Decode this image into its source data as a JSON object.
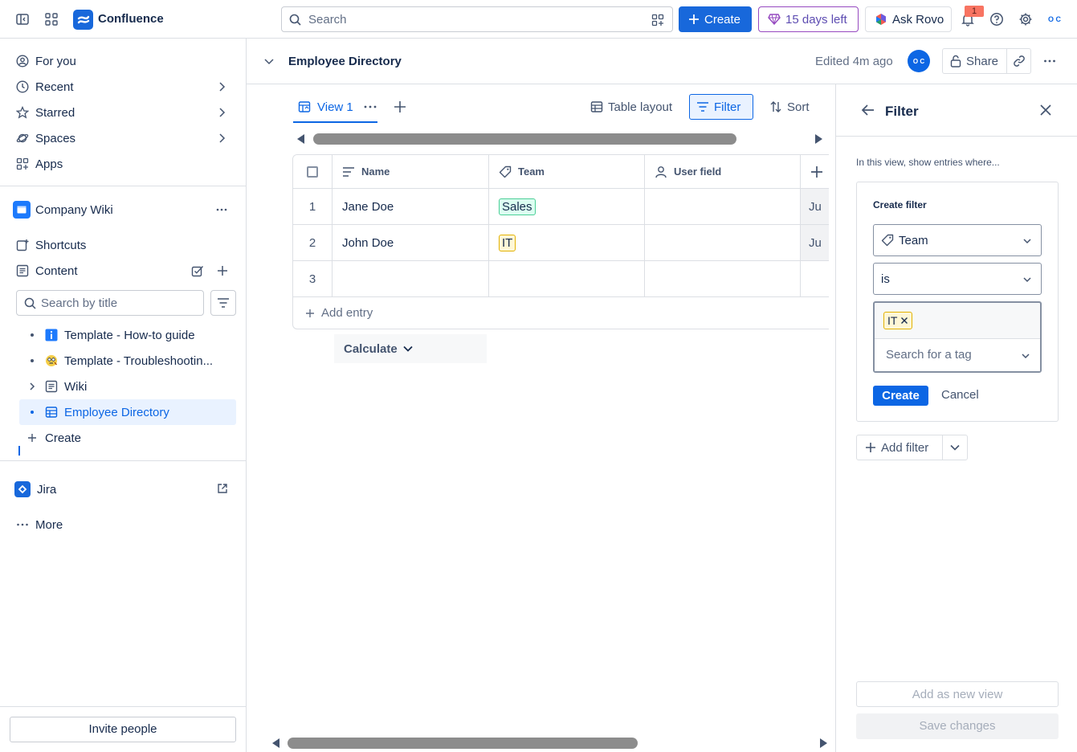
{
  "topbar": {
    "app_name": "Confluence",
    "search_placeholder": "Search",
    "create_label": "Create",
    "trial_label": "15 days left",
    "rovo_label": "Ask Rovo",
    "notification_count": "1",
    "user_initials": "O C"
  },
  "sidebar": {
    "nav": [
      {
        "label": "For you",
        "icon": "user-circle-icon"
      },
      {
        "label": "Recent",
        "icon": "clock-icon"
      },
      {
        "label": "Starred",
        "icon": "star-icon"
      },
      {
        "label": "Spaces",
        "icon": "planet-icon"
      },
      {
        "label": "Apps",
        "icon": "apps-icon"
      }
    ],
    "space_name": "Company Wiki",
    "shortcuts_label": "Shortcuts",
    "content_label": "Content",
    "search_placeholder": "Search by title",
    "tree": [
      {
        "label": "Template - How-to guide",
        "icon": "info-icon"
      },
      {
        "label": "Template - Troubleshootin...",
        "icon": "face-icon"
      },
      {
        "label": "Wiki",
        "icon": "page-icon"
      },
      {
        "label": "Employee Directory",
        "icon": "database-icon"
      }
    ],
    "create_label": "Create",
    "jira_label": "Jira",
    "more_label": "More",
    "invite_label": "Invite people"
  },
  "header": {
    "title": "Employee Directory",
    "edited": "Edited 4m ago",
    "avatar_initials": "O C",
    "share_label": "Share"
  },
  "database": {
    "view_tab": "View 1",
    "table_layout_label": "Table layout",
    "filter_label": "Filter",
    "sort_label": "Sort",
    "columns": [
      "Name",
      "Team",
      "User field"
    ],
    "rows": [
      {
        "num": "1",
        "name": "Jane Doe",
        "team": "Sales",
        "team_color": "green",
        "next": "Ju"
      },
      {
        "num": "2",
        "name": "John Doe",
        "team": "IT",
        "team_color": "yellow",
        "next": "Ju"
      },
      {
        "num": "3",
        "name": "",
        "team": "",
        "team_color": "",
        "next": ""
      }
    ],
    "add_entry_label": "Add entry",
    "calculate_label": "Calculate"
  },
  "filter_panel": {
    "title": "Filter",
    "description": "In this view, show entries where...",
    "card_title": "Create filter",
    "field_label": "Team",
    "operator_label": "is",
    "selected_tag": "IT",
    "tag_search_placeholder": "Search for a tag",
    "create_label": "Create",
    "cancel_label": "Cancel",
    "add_filter_label": "Add filter",
    "add_as_new_view_label": "Add as new view",
    "save_changes_label": "Save changes"
  },
  "colors": {
    "brand_blue": "#1868db",
    "selected_bg": "#e9f2ff",
    "trial_purple": "#964ac0"
  }
}
